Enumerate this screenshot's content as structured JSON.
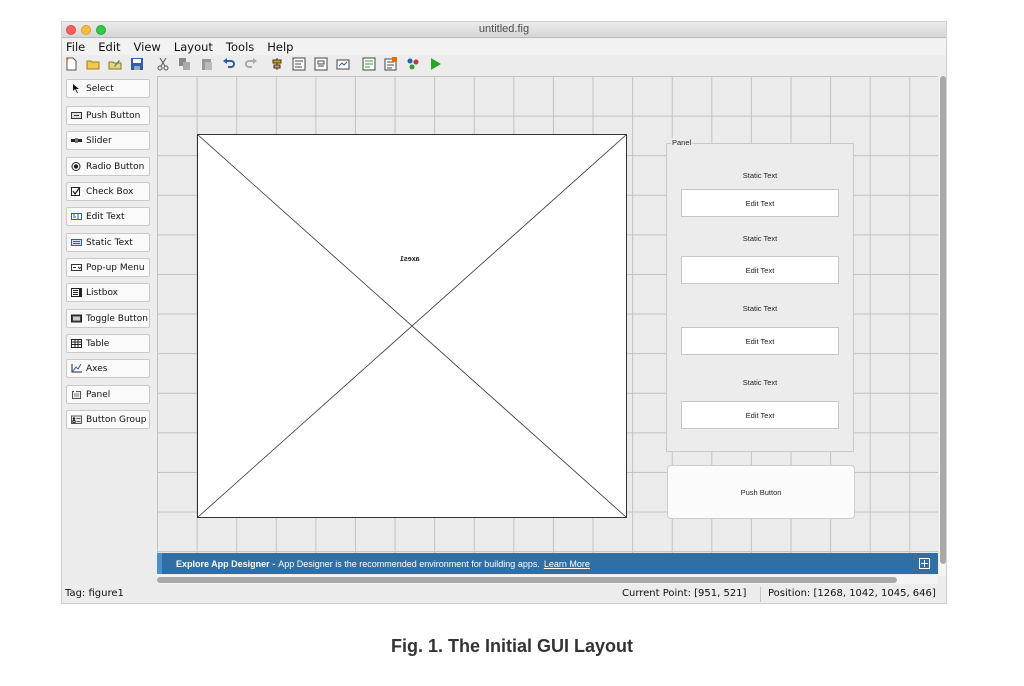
{
  "window": {
    "title": "untitled.fig"
  },
  "menubar": {
    "items": [
      "File",
      "Edit",
      "View",
      "Layout",
      "Tools",
      "Help"
    ]
  },
  "toolbar": {
    "icons": [
      "new-file-icon",
      "open-folder-icon",
      "edit-icon",
      "save-icon",
      "cut-icon",
      "copy-icon",
      "paste-icon",
      "undo-icon",
      "redo-icon",
      "align-icon",
      "menu-editor-icon",
      "tab-order-icon",
      "toolbar-editor-icon",
      "editor-icon",
      "property-inspector-icon",
      "object-browser-icon",
      "run-icon"
    ]
  },
  "palette": {
    "items": [
      {
        "label": "Select",
        "icon": "arrow-cursor-icon"
      },
      {
        "label": "Push Button",
        "icon": "push-button-icon"
      },
      {
        "label": "Slider",
        "icon": "slider-icon"
      },
      {
        "label": "Radio Button",
        "icon": "radio-button-icon"
      },
      {
        "label": "Check Box",
        "icon": "check-box-icon"
      },
      {
        "label": "Edit Text",
        "icon": "edit-text-icon"
      },
      {
        "label": "Static Text",
        "icon": "static-text-icon"
      },
      {
        "label": "Pop-up Menu",
        "icon": "popup-menu-icon"
      },
      {
        "label": "Listbox",
        "icon": "listbox-icon"
      },
      {
        "label": "Toggle Button",
        "icon": "toggle-button-icon"
      },
      {
        "label": "Table",
        "icon": "table-icon"
      },
      {
        "label": "Axes",
        "icon": "axes-icon"
      },
      {
        "label": "Panel",
        "icon": "panel-icon"
      },
      {
        "label": "Button Group",
        "icon": "button-group-icon"
      }
    ]
  },
  "canvas": {
    "axes_tag": "axes1",
    "panel": {
      "title": "Panel",
      "rows": [
        {
          "static": "Static Text",
          "edit": "Edit Text"
        },
        {
          "static": "Static Text",
          "edit": "Edit Text"
        },
        {
          "static": "Static Text",
          "edit": "Edit Text"
        },
        {
          "static": "Static Text",
          "edit": "Edit Text"
        }
      ]
    },
    "push_button": "Push Button"
  },
  "banner": {
    "strong": "Explore App Designer -",
    "text": "App Designer is the recommended environment for building apps.",
    "link": "Learn More"
  },
  "status": {
    "tag": "Tag: figure1",
    "current_point": "Current Point:  [951, 521]",
    "position": "Position: [1268, 1042, 1045, 646]"
  },
  "caption": "Fig. 1. The Initial GUI Layout",
  "colors": {
    "banner": "#2f6fa5",
    "run": "#2aa52a",
    "canvas_grid": "#c2c2c2"
  }
}
